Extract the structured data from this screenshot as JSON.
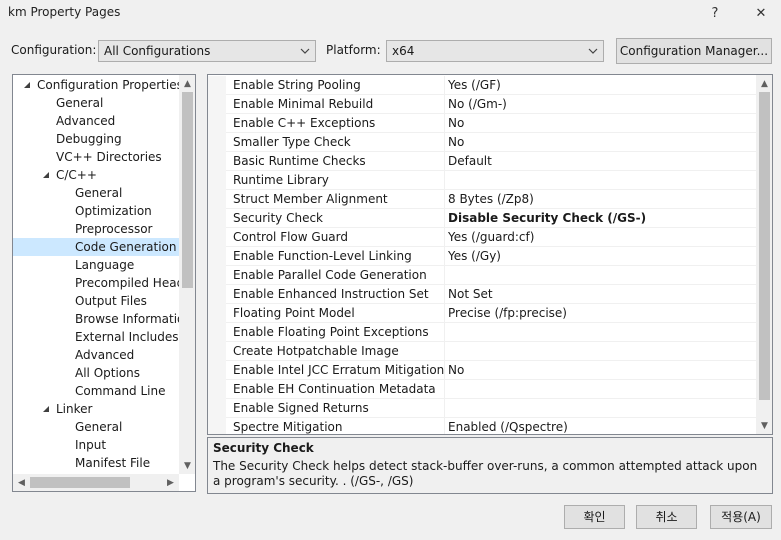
{
  "window": {
    "title": "km Property Pages",
    "help_glyph": "?",
    "close_glyph": "✕"
  },
  "config_bar": {
    "configuration_label": "Configuration:",
    "configuration_value": "All Configurations",
    "platform_label": "Platform:",
    "platform_value": "x64",
    "manager_button": "Configuration Manager..."
  },
  "tree": {
    "items": [
      {
        "label": "Configuration Properties",
        "level": 0,
        "expander": "expanded",
        "selected": false
      },
      {
        "label": "General",
        "level": 1,
        "expander": "",
        "selected": false
      },
      {
        "label": "Advanced",
        "level": 1,
        "expander": "",
        "selected": false
      },
      {
        "label": "Debugging",
        "level": 1,
        "expander": "",
        "selected": false
      },
      {
        "label": "VC++ Directories",
        "level": 1,
        "expander": "",
        "selected": false
      },
      {
        "label": "C/C++",
        "level": 1,
        "expander": "expanded",
        "selected": false
      },
      {
        "label": "General",
        "level": 2,
        "expander": "",
        "selected": false
      },
      {
        "label": "Optimization",
        "level": 2,
        "expander": "",
        "selected": false
      },
      {
        "label": "Preprocessor",
        "level": 2,
        "expander": "",
        "selected": false
      },
      {
        "label": "Code Generation",
        "level": 2,
        "expander": "",
        "selected": true
      },
      {
        "label": "Language",
        "level": 2,
        "expander": "",
        "selected": false
      },
      {
        "label": "Precompiled Heade",
        "level": 2,
        "expander": "",
        "selected": false
      },
      {
        "label": "Output Files",
        "level": 2,
        "expander": "",
        "selected": false
      },
      {
        "label": "Browse Information",
        "level": 2,
        "expander": "",
        "selected": false
      },
      {
        "label": "External Includes",
        "level": 2,
        "expander": "",
        "selected": false
      },
      {
        "label": "Advanced",
        "level": 2,
        "expander": "",
        "selected": false
      },
      {
        "label": "All Options",
        "level": 2,
        "expander": "",
        "selected": false
      },
      {
        "label": "Command Line",
        "level": 2,
        "expander": "",
        "selected": false
      },
      {
        "label": "Linker",
        "level": 1,
        "expander": "expanded",
        "selected": false
      },
      {
        "label": "General",
        "level": 2,
        "expander": "",
        "selected": false
      },
      {
        "label": "Input",
        "level": 2,
        "expander": "",
        "selected": false
      },
      {
        "label": "Manifest File",
        "level": 2,
        "expander": "",
        "selected": false
      }
    ]
  },
  "properties": [
    {
      "name": "Enable String Pooling",
      "value": "Yes (/GF)",
      "selected": false
    },
    {
      "name": "Enable Minimal Rebuild",
      "value": "No (/Gm-)",
      "selected": false
    },
    {
      "name": "Enable C++ Exceptions",
      "value": "No",
      "selected": false
    },
    {
      "name": "Smaller Type Check",
      "value": "No",
      "selected": false
    },
    {
      "name": "Basic Runtime Checks",
      "value": "Default",
      "selected": false
    },
    {
      "name": "Runtime Library",
      "value": "",
      "selected": false
    },
    {
      "name": "Struct Member Alignment",
      "value": "8 Bytes (/Zp8)",
      "selected": false
    },
    {
      "name": "Security Check",
      "value": "Disable Security Check (/GS-)",
      "selected": true
    },
    {
      "name": "Control Flow Guard",
      "value": "Yes (/guard:cf)",
      "selected": false
    },
    {
      "name": "Enable Function-Level Linking",
      "value": "Yes (/Gy)",
      "selected": false
    },
    {
      "name": "Enable Parallel Code Generation",
      "value": "",
      "selected": false
    },
    {
      "name": "Enable Enhanced Instruction Set",
      "value": "Not Set",
      "selected": false
    },
    {
      "name": "Floating Point Model",
      "value": "Precise (/fp:precise)",
      "selected": false
    },
    {
      "name": "Enable Floating Point Exceptions",
      "value": "",
      "selected": false
    },
    {
      "name": "Create Hotpatchable Image",
      "value": "",
      "selected": false
    },
    {
      "name": "Enable Intel JCC Erratum Mitigation",
      "value": "No",
      "selected": false
    },
    {
      "name": "Enable EH Continuation Metadata",
      "value": "",
      "selected": false
    },
    {
      "name": "Enable Signed Returns",
      "value": "",
      "selected": false
    },
    {
      "name": "Spectre Mitigation",
      "value": "Enabled (/Qspectre)",
      "selected": false
    }
  ],
  "description": {
    "title": "Security Check",
    "text": "The Security Check helps detect stack-buffer over-runs, a common attempted attack upon a program's security.  .  (/GS-, /GS)"
  },
  "buttons": {
    "ok": "확인",
    "cancel": "취소",
    "apply": "적용(A)"
  },
  "colors": {
    "tree_selection": "#cce8ff",
    "window_bg": "#f0f0f0",
    "border": "#828790"
  }
}
